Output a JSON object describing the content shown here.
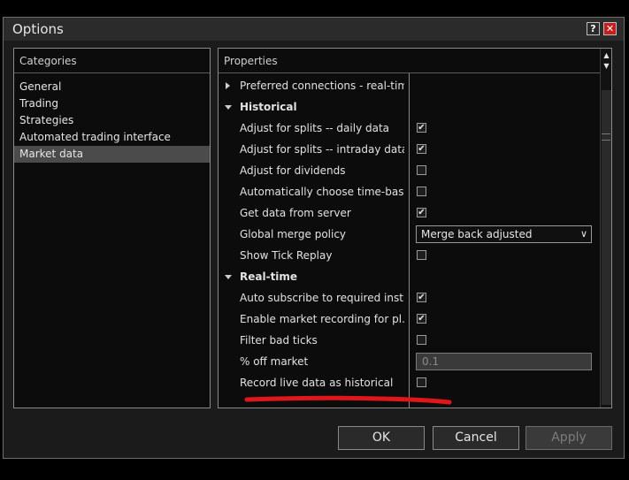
{
  "window": {
    "title": "Options",
    "help_label": "?",
    "close_label": "✕"
  },
  "categories": {
    "header": "Categories",
    "items": [
      "General",
      "Trading",
      "Strategies",
      "Automated trading interface",
      "Market data"
    ],
    "selected": "Market data"
  },
  "properties": {
    "header": "Properties",
    "rows": [
      {
        "label": "Preferred connections - real-time",
        "kind": "collapsed-category"
      },
      {
        "label": "Historical",
        "kind": "category"
      },
      {
        "label": "Adjust for splits -- daily data",
        "kind": "checkbox",
        "checked": true
      },
      {
        "label": "Adjust for splits -- intraday data",
        "kind": "checkbox",
        "checked": true
      },
      {
        "label": "Adjust for dividends",
        "kind": "checkbox",
        "checked": false
      },
      {
        "label": "Automatically choose time-bas…",
        "kind": "checkbox",
        "checked": false
      },
      {
        "label": "Get data from server",
        "kind": "checkbox",
        "checked": true
      },
      {
        "label": "Global merge policy",
        "kind": "select",
        "value": "Merge back adjusted"
      },
      {
        "label": "Show Tick Replay",
        "kind": "checkbox",
        "checked": false
      },
      {
        "label": "Real-time",
        "kind": "category"
      },
      {
        "label": "Auto subscribe to required instr…",
        "kind": "checkbox",
        "checked": true
      },
      {
        "label": "Enable market recording for pl…",
        "kind": "checkbox",
        "checked": true
      },
      {
        "label": "Filter bad ticks",
        "kind": "checkbox",
        "checked": false
      },
      {
        "label": "% off market",
        "kind": "text",
        "value": "0.1"
      },
      {
        "label": "Record live data as historical",
        "kind": "checkbox",
        "checked": false
      }
    ]
  },
  "buttons": {
    "ok": "OK",
    "cancel": "Cancel",
    "apply": "Apply"
  },
  "colors": {
    "annotation": "#e0161b",
    "close": "#c41e1e",
    "selected": "#4b4b4b"
  }
}
